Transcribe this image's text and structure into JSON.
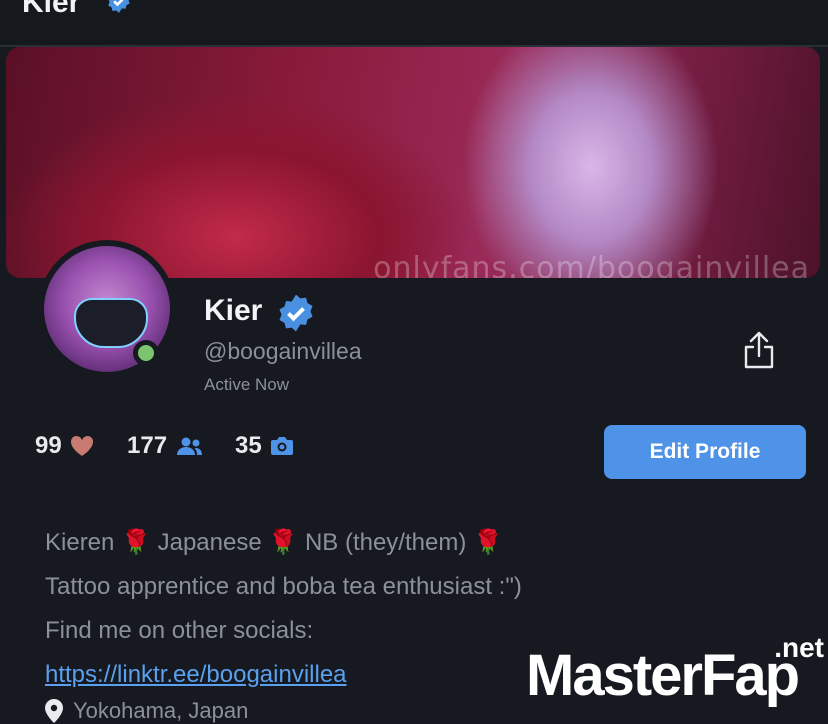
{
  "header": {
    "title": "Kier"
  },
  "banner": {
    "watermark": "onlyfans.com/boogainvillea"
  },
  "profile": {
    "name": "Kier",
    "handle": "@boogainvillea",
    "status": "Active Now"
  },
  "stats": {
    "likes": "99",
    "subscribers": "177",
    "photos": "35"
  },
  "actions": {
    "edit_profile": "Edit Profile"
  },
  "bio": {
    "line1_parts": [
      "Kieren",
      "Japanese",
      "NB (they/them)"
    ],
    "line2": "Tattoo apprentice and boba tea enthusiast :\")",
    "line3": "Find me on other socials:",
    "link": "https://linktr.ee/boogainvillea",
    "location": "Yokohama, Japan"
  },
  "watermark": {
    "main": "MasterFap",
    "suffix": ".net"
  },
  "colors": {
    "accent": "#4f93e8",
    "verified": "#4a90e2",
    "online": "#7cc46f",
    "heart": "#c97a72",
    "stat_icon": "#4f93e8"
  },
  "icons": {
    "verified": "verified-badge-icon",
    "share": "share-icon",
    "heart": "heart-icon",
    "users": "users-icon",
    "camera": "camera-icon",
    "location": "location-pin-icon"
  }
}
